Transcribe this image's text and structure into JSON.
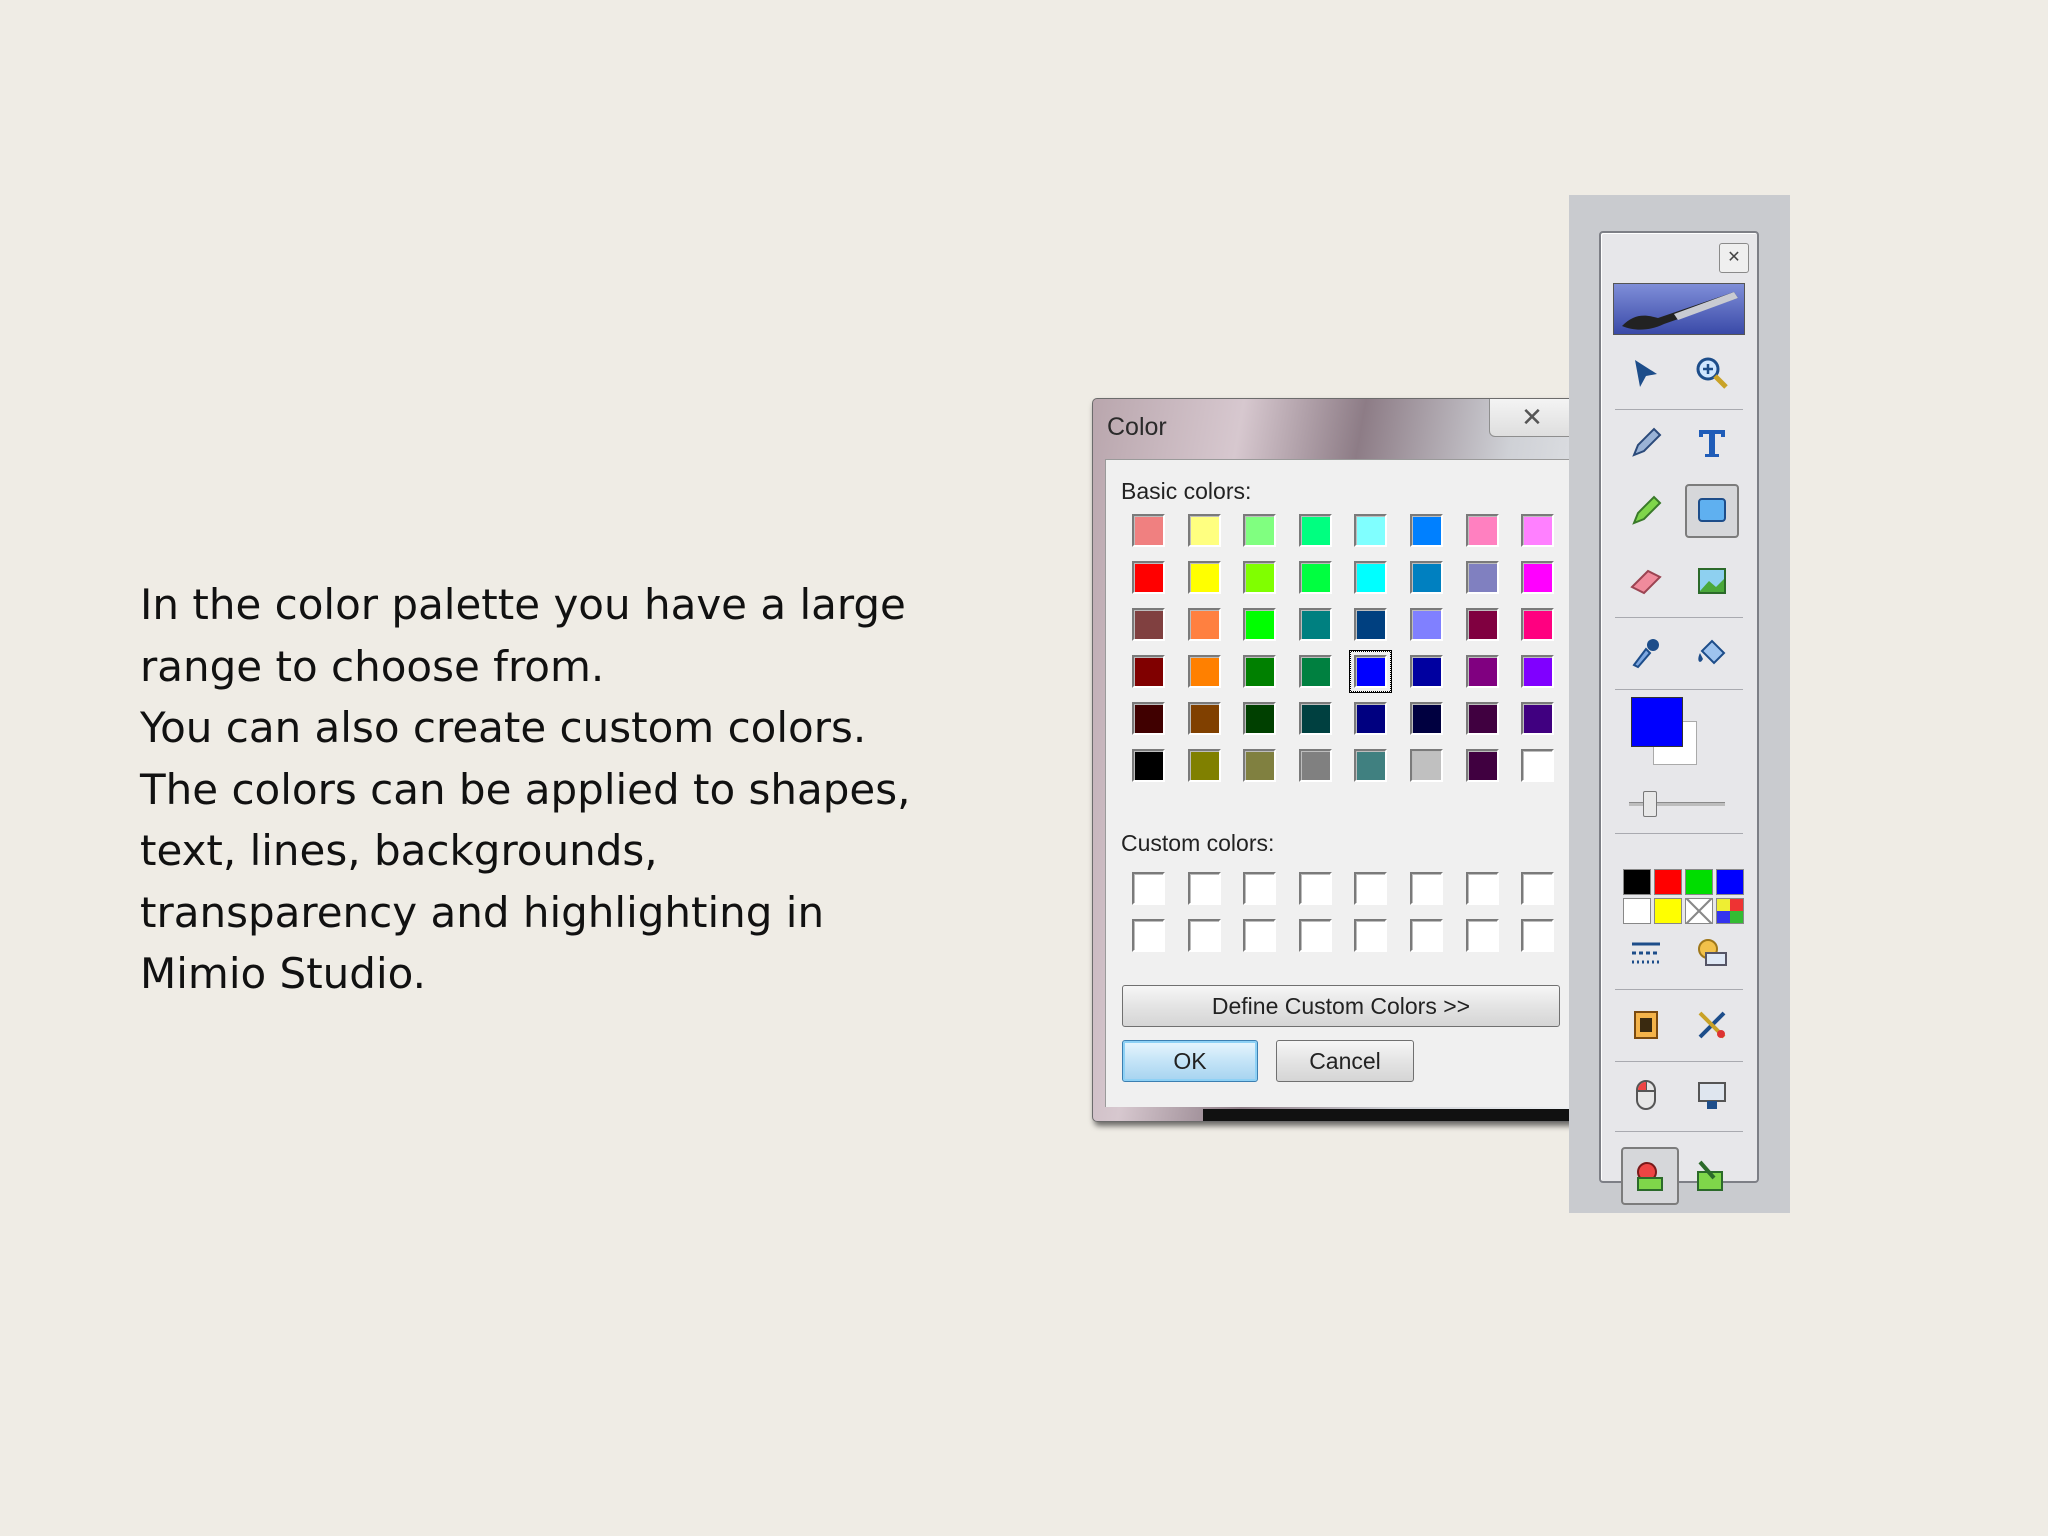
{
  "slide": {
    "lines": [
      "In the color palette you have a large",
      "range to choose from.",
      "You can also create custom colors.",
      "The colors can be applied to shapes,",
      "text, lines, backgrounds,",
      "transparency and highlighting in",
      "Mimio Studio."
    ]
  },
  "dialog": {
    "title": "Color",
    "close_glyph": "✕",
    "basic_colors_label": "Basic colors:",
    "custom_colors_label": "Custom colors:",
    "define_custom_label": "Define Custom Colors >>",
    "ok_label": "OK",
    "cancel_label": "Cancel",
    "basic_colors": [
      "#F08080",
      "#FFFF80",
      "#80FF80",
      "#00FF80",
      "#80FFFF",
      "#0080FF",
      "#FF80C0",
      "#FF80FF",
      "#FF0000",
      "#FFFF00",
      "#80FF00",
      "#00FF40",
      "#00FFFF",
      "#0080C0",
      "#8080C0",
      "#FF00FF",
      "#804040",
      "#FF8040",
      "#00FF00",
      "#008080",
      "#004080",
      "#8080FF",
      "#800040",
      "#FF0080",
      "#800000",
      "#FF8000",
      "#008000",
      "#008040",
      "#0000FF",
      "#0000A0",
      "#800080",
      "#8000FF",
      "#400000",
      "#804000",
      "#004000",
      "#004040",
      "#000080",
      "#000040",
      "#400040",
      "#400080",
      "#000000",
      "#808000",
      "#808040",
      "#808080",
      "#408080",
      "#C0C0C0",
      "#400040",
      "#FFFFFF"
    ],
    "selected_index": 28,
    "custom_colors": [
      "#FFFFFF",
      "#FFFFFF",
      "#FFFFFF",
      "#FFFFFF",
      "#FFFFFF",
      "#FFFFFF",
      "#FFFFFF",
      "#FFFFFF",
      "#FFFFFF",
      "#FFFFFF",
      "#FFFFFF",
      "#FFFFFF",
      "#FFFFFF",
      "#FFFFFF",
      "#FFFFFF",
      "#FFFFFF"
    ]
  },
  "toolbar": {
    "close_glyph": "✕",
    "foreground_color": "#0000FF",
    "background_color": "#FFFFFF",
    "quick_palette": [
      "#000000",
      "#FF0000",
      "#00DD00",
      "#0000FF",
      "#FFFFFF",
      "#FFFF00",
      "transparent",
      "multi"
    ],
    "tools": [
      [
        "select-arrow-icon",
        "zoom-icon"
      ],
      [
        "pen-icon",
        "text-tool-icon"
      ],
      [
        "highlighter-icon",
        "shape-tool-icon"
      ],
      [
        "eraser-icon",
        "image-icon"
      ],
      [
        "eyedropper-icon",
        "fill-bucket-icon"
      ]
    ]
  }
}
